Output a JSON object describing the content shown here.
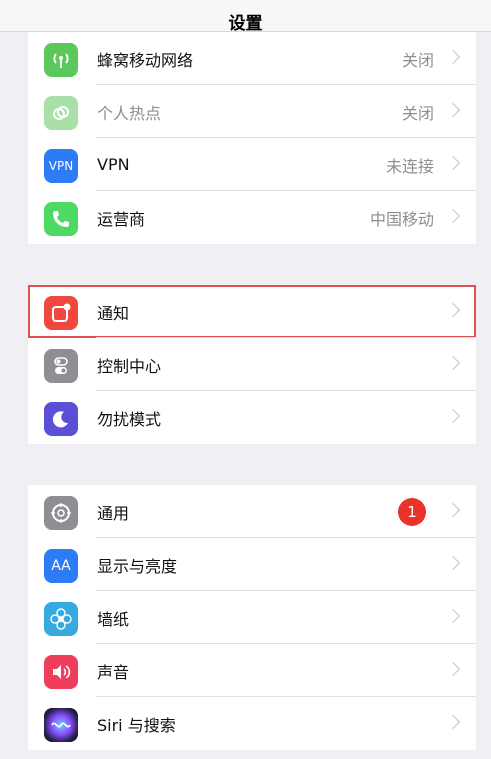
{
  "nav": {
    "title": "设置"
  },
  "group1": [
    {
      "label": "蜂窝移动网络",
      "value": "关闭",
      "icon": "antenna-icon",
      "color": "#5ac85a"
    },
    {
      "label": "个人热点",
      "value": "关闭",
      "icon": "hotspot-icon",
      "color": "#a8e0a8"
    },
    {
      "label": "VPN",
      "value": "未连接",
      "icon": "vpn-icon",
      "color": "#2d7cf6"
    },
    {
      "label": "运营商",
      "value": "中国移动",
      "icon": "phone-icon",
      "color": "#4cd964"
    }
  ],
  "group2": [
    {
      "label": "通知",
      "icon": "notification-icon",
      "color": "#f0483e"
    },
    {
      "label": "控制中心",
      "icon": "toggle-icon",
      "color": "#8e8e93"
    },
    {
      "label": "勿扰模式",
      "icon": "moon-icon",
      "color": "#5b4fd6"
    }
  ],
  "group3": [
    {
      "label": "通用",
      "badge": "1",
      "icon": "gear-icon",
      "color": "#8e8e93"
    },
    {
      "label": "显示与亮度",
      "icon": "display-icon",
      "color": "#2d7cf6",
      "glyph": "AA"
    },
    {
      "label": "墙纸",
      "icon": "wallpaper-icon",
      "color": "#36a9e1"
    },
    {
      "label": "声音",
      "icon": "speaker-icon",
      "color": "#ef3d5b"
    },
    {
      "label": "Siri 与搜索",
      "icon": "siri-icon",
      "color": "#1c1c3a"
    }
  ]
}
